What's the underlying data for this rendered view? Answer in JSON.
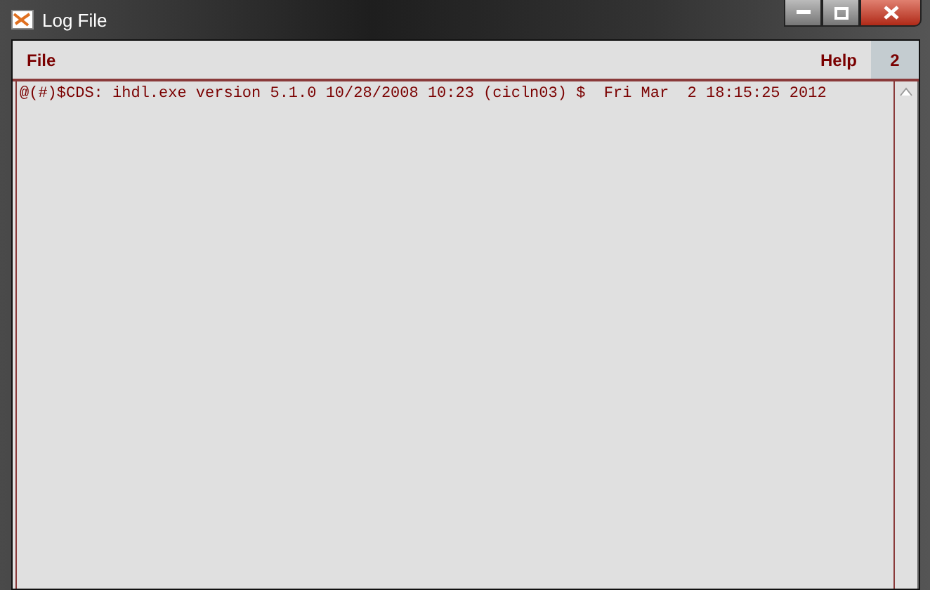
{
  "window": {
    "title": "Log File"
  },
  "menu": [
    {
      "label": "File"
    },
    {
      "label": "Help"
    }
  ],
  "badge": "2",
  "log": {
    "lines": [
      "@(#)$CDS: ihdl.exe version 5.1.0 10/28/2008 10:23 (cicln03) $  Fri Mar  2 18:15:25 2012"
    ]
  }
}
